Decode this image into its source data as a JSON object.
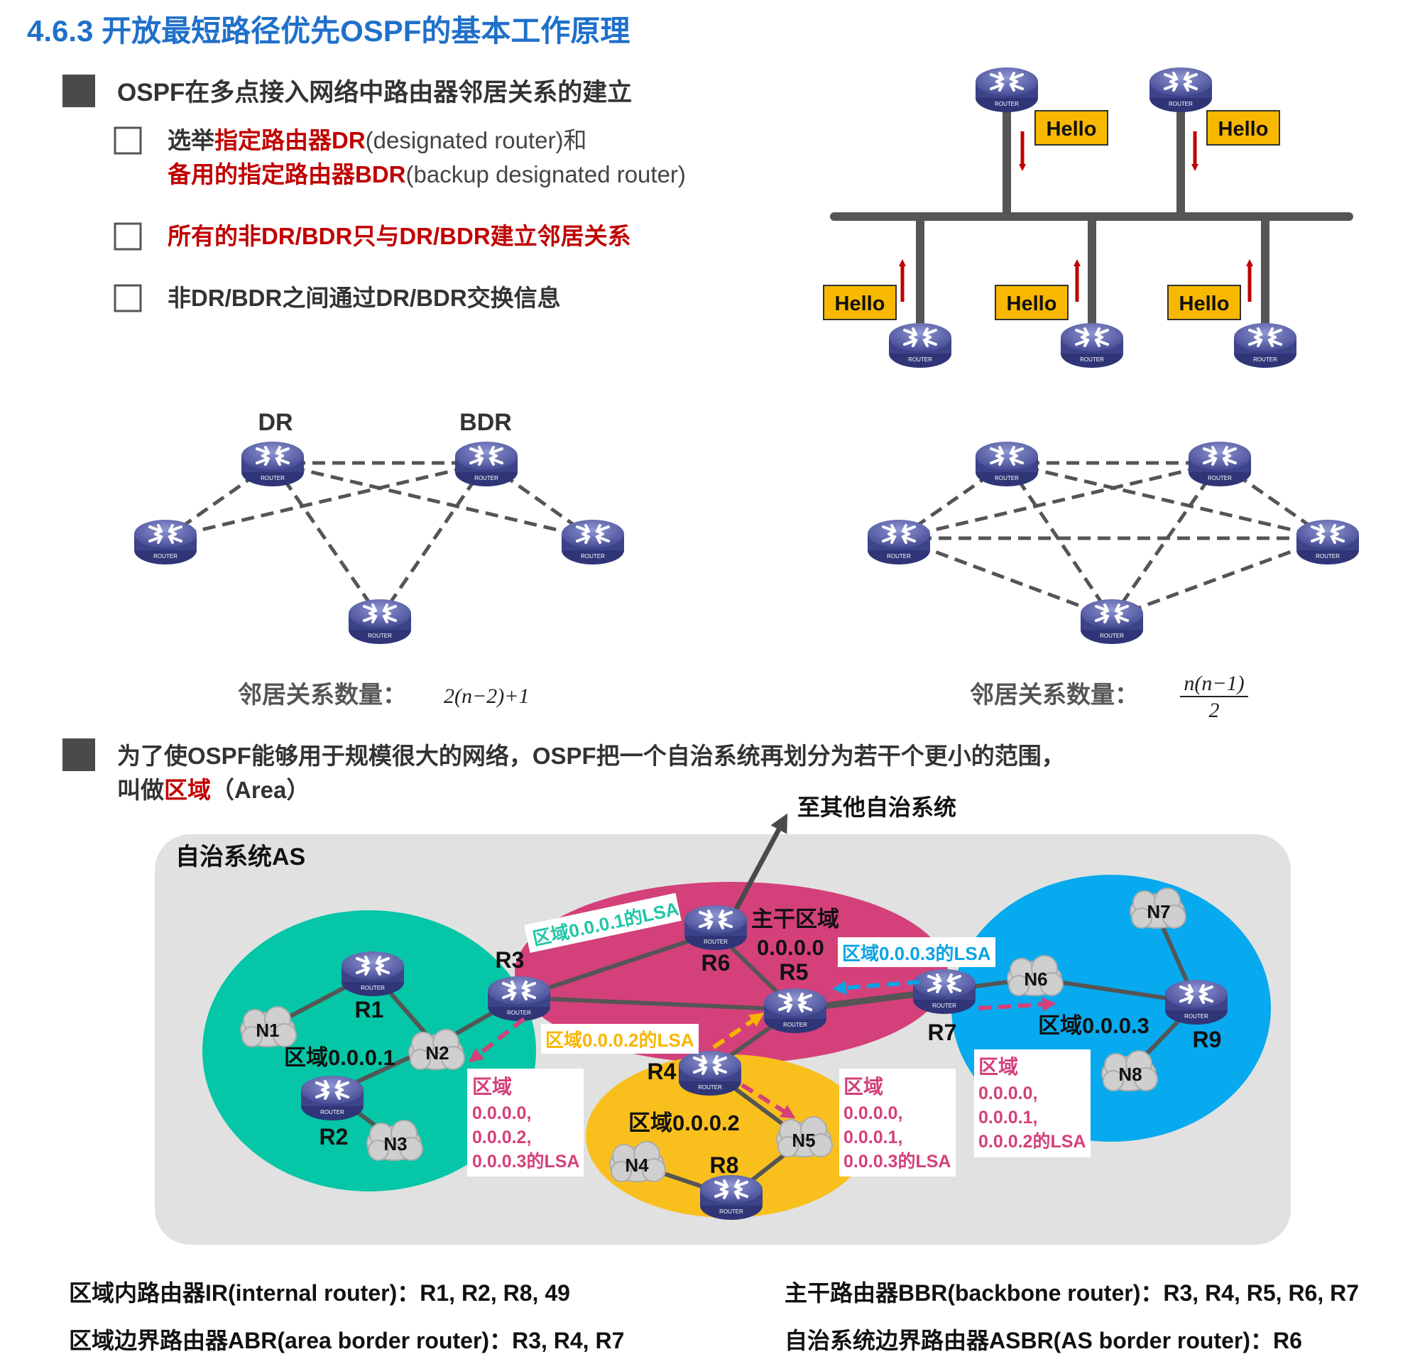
{
  "page": {
    "title": "4.6.3 开放最短路径优先OSPF的基本工作原理"
  },
  "section1": {
    "heading": "OSPF在多点接入网络中路由器邻居关系的建立",
    "item1": {
      "prefix": "选举",
      "dr_red": "指定路由器DR",
      "dr_paren": "(designated router)和",
      "bdr_red": "备用的指定路由器BDR",
      "bdr_paren": "(backup designated router)"
    },
    "item2": "所有的非DR/BDR只与DR/BDR建立邻居关系",
    "item3": "非DR/BDR之间通过DR/BDR交换信息"
  },
  "hello_diagram": {
    "label": "Hello",
    "router_label": "ROUTER"
  },
  "topology_left": {
    "dr_label": "DR",
    "bdr_label": "BDR",
    "count_label": "邻居关系数量：",
    "formula": "2(n−2)+1"
  },
  "topology_right": {
    "count_label": "邻居关系数量：",
    "formula_num": "n(n−1)",
    "formula_den": "2"
  },
  "section2": {
    "line1": "为了使OSPF能够用于规模很大的网络，OSPF把一个自治系统再划分为若干个更小的范围，",
    "line2_prefix": "叫做",
    "line2_red": "区域",
    "line2_suffix": "（Area）"
  },
  "as_diagram": {
    "to_other_as": "至其他自治系统",
    "as_label": "自治系统AS",
    "backbone_label_1": "主干区域",
    "backbone_label_2": "0.0.0.0",
    "area1_label": "区域0.0.0.1",
    "area2_label": "区域0.0.0.2",
    "area3_label": "区域0.0.0.3",
    "routers": [
      "R1",
      "R2",
      "R3",
      "R4",
      "R5",
      "R6",
      "R7",
      "R8",
      "R9"
    ],
    "networks": [
      "N1",
      "N2",
      "N3",
      "N4",
      "N5",
      "N6",
      "N7",
      "N8"
    ],
    "lsa_area1": "区域0.0.0.1的LSA",
    "lsa_area2": "区域0.0.0.2的LSA",
    "lsa_area3": "区域0.0.0.3的LSA",
    "box_r3": [
      "区域",
      "0.0.0.0,",
      "0.0.0.2,",
      "0.0.0.3的LSA"
    ],
    "box_r4": [
      "区域",
      "0.0.0.0,",
      "0.0.0.1,",
      "0.0.0.3的LSA"
    ],
    "box_r7": [
      "区域",
      "0.0.0.0,",
      "0.0.0.1,",
      "0.0.0.2的LSA"
    ],
    "colors": {
      "area1": "#05c6a6",
      "backbone": "#d4407a",
      "area2": "#f9bf1d",
      "area3": "#07aaee",
      "as_bg": "#e1e1e1",
      "router": "#5159a3"
    }
  },
  "footer": {
    "ir_label": "区域内路由器IR(internal router)：",
    "ir_value": "R1, R2, R8, 49",
    "bbr_label": "主干路由器BBR(backbone router)：",
    "bbr_value": "R3, R4, R5, R6, R7",
    "abr_label": "区域边界路由器ABR(area border router)：",
    "abr_value": "R3, R4, R7",
    "asbr_label": "自治系统边界路由器ASBR(AS border router)：",
    "asbr_value": "R6"
  }
}
